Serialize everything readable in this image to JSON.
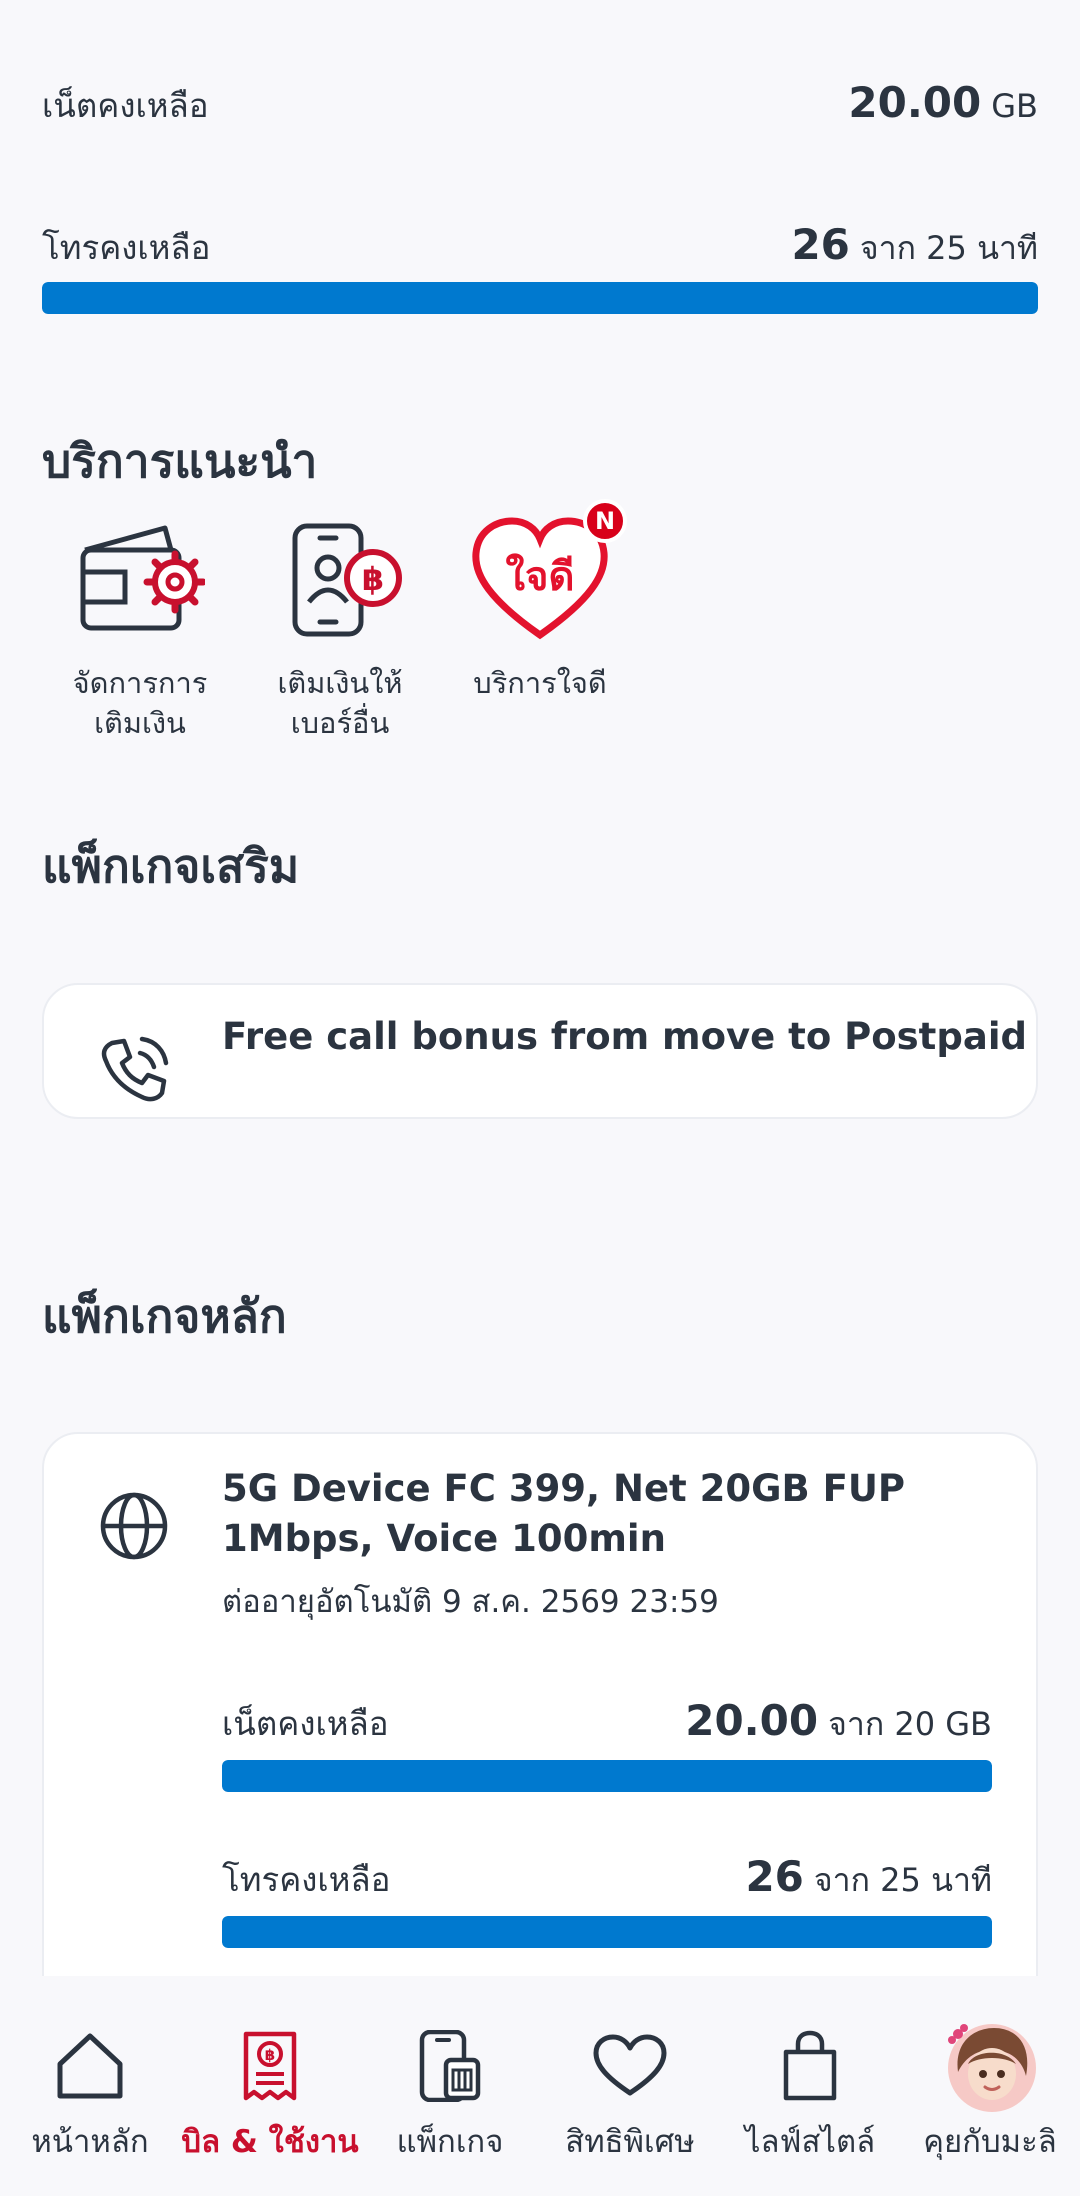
{
  "summary": {
    "data_label": "เน็ตคงเหลือ",
    "data_value": "20.00",
    "data_unit": "GB",
    "voice_label": "โทรคงเหลือ",
    "voice_value": "26",
    "voice_unit": "จาก 25 นาที",
    "voice_fill_pct": 100
  },
  "recommended": {
    "title": "บริการแนะนำ",
    "items": [
      {
        "label_line1": "จัดการการ",
        "label_line2": "เติมเงิน"
      },
      {
        "label_line1": "เติมเงินให้",
        "label_line2": "เบอร์อื่น"
      },
      {
        "label_line1": "บริการใจดี",
        "label_line2": "",
        "badge": "N",
        "heart_text": "ใจดี"
      }
    ]
  },
  "addon": {
    "title": "แพ็กเกจเสริม",
    "item_label": "Free call bonus from move to Postpaid"
  },
  "main_package": {
    "title": "แพ็กเกจหลัก",
    "name": "5G Device FC 399, Net 20GB FUP 1Mbps, Voice 100min",
    "renew_text": "ต่ออายุอัตโนมัติ 9 ส.ค. 2569 23:59",
    "data_label": "เน็ตคงเหลือ",
    "data_value": "20.00",
    "data_unit": "จาก 20 GB",
    "data_fill_pct": 100,
    "voice_label": "โทรคงเหลือ",
    "voice_value": "26",
    "voice_unit": "จาก 25 นาที",
    "voice_fill_pct": 100
  },
  "nav": {
    "items": [
      {
        "label": "หน้าหลัก"
      },
      {
        "label": "บิล & ใช้งาน",
        "active": true
      },
      {
        "label": "แพ็กเกจ"
      },
      {
        "label": "สิทธิพิเศษ"
      },
      {
        "label": "ไลฟ์สไตล์"
      },
      {
        "label": "คุยกับมะลิ"
      }
    ]
  },
  "colors": {
    "accent": "#0079cf",
    "brand_red": "#c8102e",
    "text": "#2b3440"
  }
}
